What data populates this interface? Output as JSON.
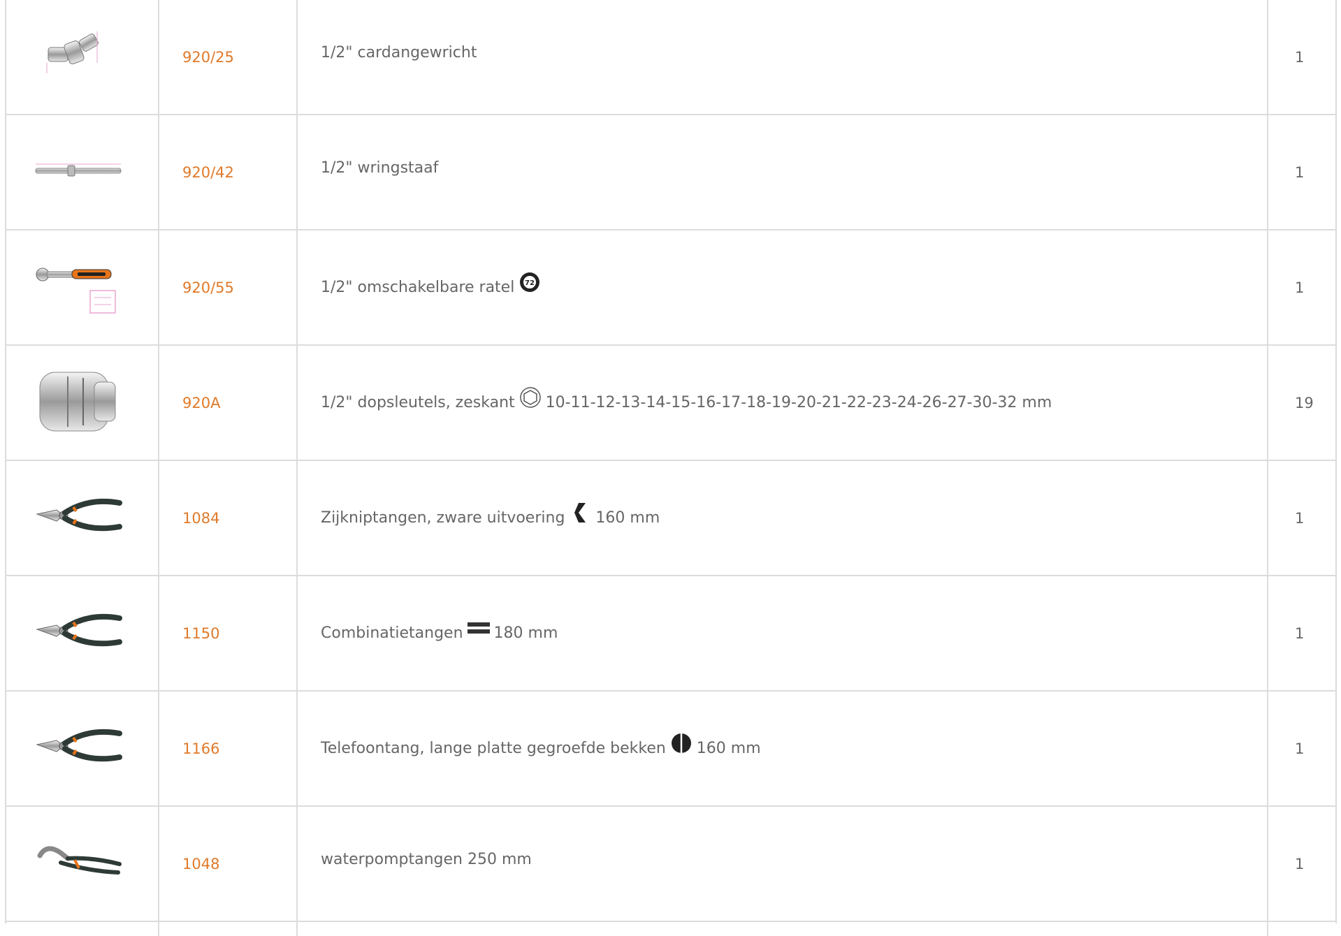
{
  "table": {
    "rows": [
      {
        "code": "920/25",
        "description": "1/2\" cardangewricht",
        "symbol": "",
        "suffix": "",
        "quantity": "1",
        "image_icon": "universal-joint-icon"
      },
      {
        "code": "920/42",
        "description": "1/2\" wringstaaf",
        "symbol": "",
        "suffix": "",
        "quantity": "1",
        "image_icon": "breaker-bar-icon"
      },
      {
        "code": "920/55",
        "description": "1/2\" omschakelbare ratel",
        "symbol": "ratchet-72-teeth-icon",
        "suffix": "",
        "quantity": "1",
        "image_icon": "ratchet-icon"
      },
      {
        "code": "920A",
        "description": "1/2\" dopsleutels, zeskant",
        "symbol": "hexagon-icon",
        "suffix": "10-11-12-13-14-15-16-17-18-19-20-21-22-23-24-26-27-30-32 mm",
        "quantity": "19",
        "image_icon": "socket-icon"
      },
      {
        "code": "1084",
        "description": "Zijkniptangen, zware uitvoering",
        "symbol": "side-cutter-icon",
        "suffix": "160 mm",
        "quantity": "1",
        "image_icon": "diagonal-pliers-icon"
      },
      {
        "code": "1150",
        "description": "Combinatietangen",
        "symbol": "flat-jaws-icon",
        "suffix": "180 mm",
        "quantity": "1",
        "image_icon": "combination-pliers-icon"
      },
      {
        "code": "1166",
        "description": "Telefoontang, lange platte gegroefde bekken",
        "symbol": "half-round-jaws-icon",
        "suffix": "160 mm",
        "quantity": "1",
        "image_icon": "long-nose-pliers-icon"
      },
      {
        "code": "1048",
        "description": "waterpomptangen 250 mm",
        "symbol": "",
        "suffix": "",
        "quantity": "1",
        "image_icon": "water-pump-pliers-icon"
      }
    ]
  },
  "colors": {
    "code": "#e07a2a",
    "text": "#666666",
    "border": "#dcdcdc",
    "handle_orange": "#e8751a",
    "handle_dark": "#2e3a36"
  }
}
